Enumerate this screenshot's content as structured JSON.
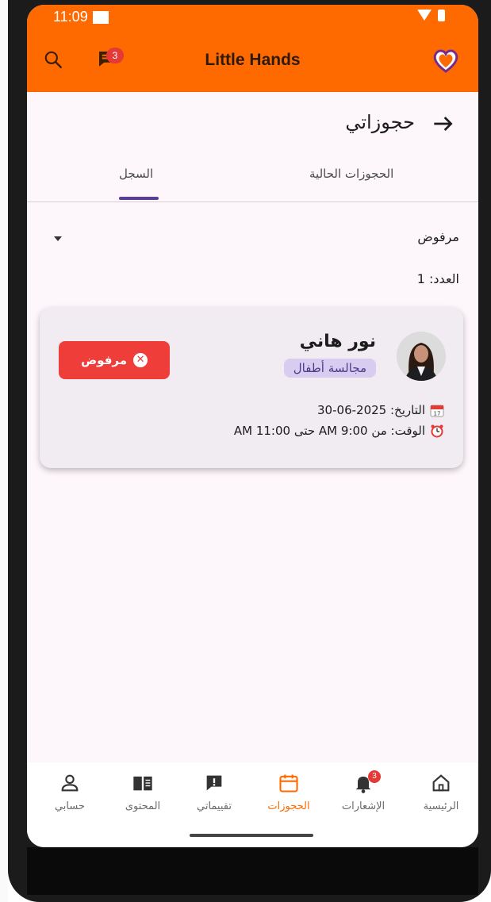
{
  "status_bar": {
    "time": "11:09"
  },
  "app_bar": {
    "title": "Little Hands",
    "chat_badge": "3",
    "icons": [
      "search-icon",
      "chat-icon",
      "heart-logo-icon"
    ]
  },
  "page": {
    "title": "حجوزاتي",
    "tabs": [
      {
        "label": "الحجوزات الحالية",
        "active": false
      },
      {
        "label": "السجل",
        "active": true
      }
    ]
  },
  "filter": {
    "selected": "مرفوض"
  },
  "count_text": "العدد: 1",
  "bookings": [
    {
      "name": "نور هاني",
      "service": "مجالسة أطفال",
      "status": "مرفوض",
      "date_text": "التاريخ: 2025-06-30",
      "time_text": "الوقت: من 9:00 AM حتى 11:00 AM"
    }
  ],
  "bottom_nav": {
    "items": [
      {
        "label": "الرئيسية",
        "icon": "home-icon"
      },
      {
        "label": "الإشعارات",
        "icon": "bell-icon",
        "badge": "3"
      },
      {
        "label": "الحجوزات",
        "icon": "calendar-icon",
        "active": true
      },
      {
        "label": "تقييماتي",
        "icon": "review-icon"
      },
      {
        "label": "المحتوى",
        "icon": "book-icon"
      },
      {
        "label": "حسابي",
        "icon": "person-icon"
      }
    ]
  },
  "colors": {
    "primary": "#ff6a00",
    "rejected": "#ef3e3a",
    "tag_bg": "#d8ccf0",
    "tab_indicator": "#5a3e96"
  }
}
